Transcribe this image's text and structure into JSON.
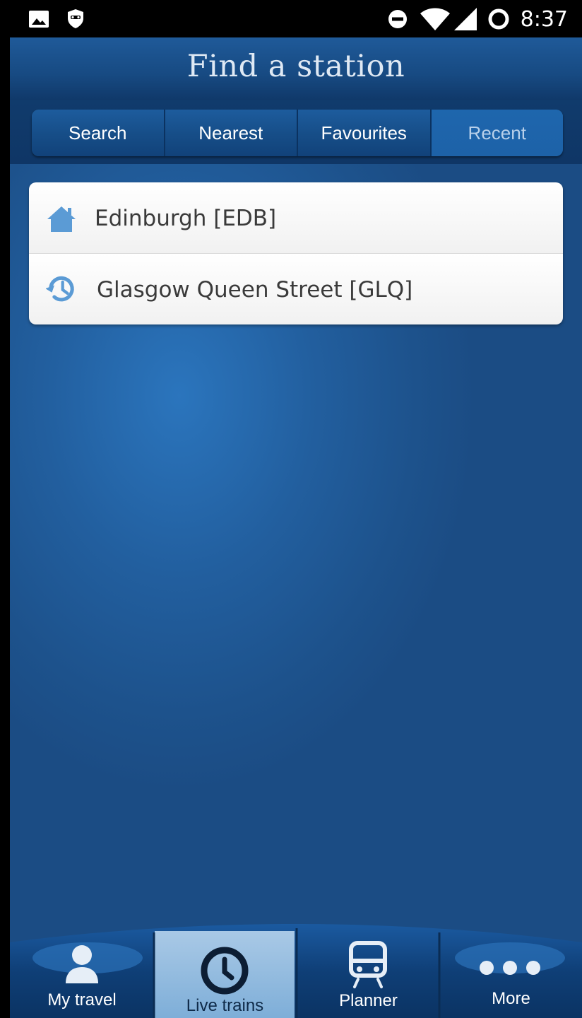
{
  "status_bar": {
    "time": "8:37",
    "icons": [
      "gallery-icon",
      "privacy-mask-icon",
      "do-not-disturb-icon",
      "wifi-icon",
      "cell-signal-icon",
      "battery-icon"
    ]
  },
  "header": {
    "title": "Find a station"
  },
  "tabs": [
    {
      "label": "Search",
      "active": false
    },
    {
      "label": "Nearest",
      "active": false
    },
    {
      "label": "Favourites",
      "active": false
    },
    {
      "label": "Recent",
      "active": true
    }
  ],
  "stations": [
    {
      "label": "Edinburgh [EDB]",
      "icon": "home-icon"
    },
    {
      "label": "Glasgow Queen Street [GLQ]",
      "icon": "history-icon"
    }
  ],
  "bottom_nav": {
    "items": [
      {
        "label": "My travel",
        "icon": "person-icon",
        "active": false
      },
      {
        "label": "Live trains",
        "icon": "clock-icon",
        "active": true
      },
      {
        "label": "Planner",
        "icon": "train-icon",
        "active": false
      },
      {
        "label": "More",
        "icon": "more-dots-icon",
        "active": false
      }
    ]
  },
  "colors": {
    "accent": "#5b9bd5",
    "background": "#225f9f",
    "header": "#174a82",
    "active_tab_text": "#b8d0ea"
  }
}
